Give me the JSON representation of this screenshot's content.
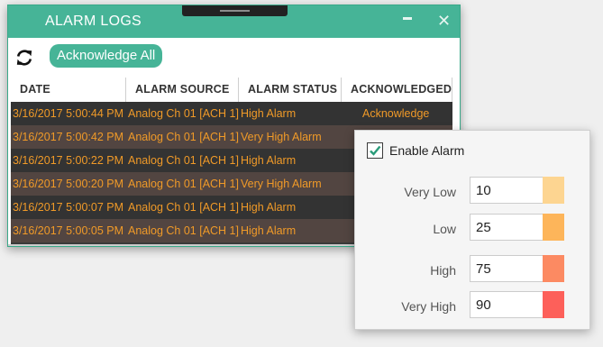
{
  "window": {
    "title": "ALARM LOGS",
    "close_label": "✕"
  },
  "toolbar": {
    "refresh_icon": "refresh-icon",
    "acknowledge_all_label": "Acknowledge All"
  },
  "table": {
    "columns": [
      "DATE",
      "ALARM SOURCE",
      "ALARM STATUS",
      "ACKNOWLEDGED"
    ],
    "rows": [
      {
        "date": "3/16/2017 5:00:44 PM",
        "source": "Analog Ch 01 [ACH 1]",
        "status": "High Alarm",
        "acknowledged": "Acknowledge"
      },
      {
        "date": "3/16/2017 5:00:42 PM",
        "source": "Analog Ch 01 [ACH 1]",
        "status": "Very High Alarm",
        "acknowledged": ""
      },
      {
        "date": "3/16/2017 5:00:22 PM",
        "source": "Analog Ch 01 [ACH 1]",
        "status": "High Alarm",
        "acknowledged": ""
      },
      {
        "date": "3/16/2017 5:00:20 PM",
        "source": "Analog Ch 01 [ACH 1]",
        "status": "Very High Alarm",
        "acknowledged": ""
      },
      {
        "date": "3/16/2017 5:00:07 PM",
        "source": "Analog Ch 01 [ACH 1]",
        "status": "High Alarm",
        "acknowledged": ""
      },
      {
        "date": "3/16/2017 5:00:05 PM",
        "source": "Analog Ch 01 [ACH 1]",
        "status": "High Alarm",
        "acknowledged": ""
      }
    ]
  },
  "alarm_settings": {
    "enable_label": "Enable Alarm",
    "enabled": true,
    "levels": [
      {
        "label": "Very Low",
        "value": "10",
        "color": "#fdd591"
      },
      {
        "label": "Low",
        "value": "25",
        "color": "#fdb55a"
      },
      {
        "label": "High",
        "value": "75",
        "color": "#fc8a62"
      },
      {
        "label": "Very High",
        "value": "90",
        "color": "#fd605a"
      }
    ]
  },
  "colors": {
    "accent": "#46b497",
    "alarm_text": "#f09a28",
    "row_dark": "#333333",
    "row_alt": "#524541"
  }
}
